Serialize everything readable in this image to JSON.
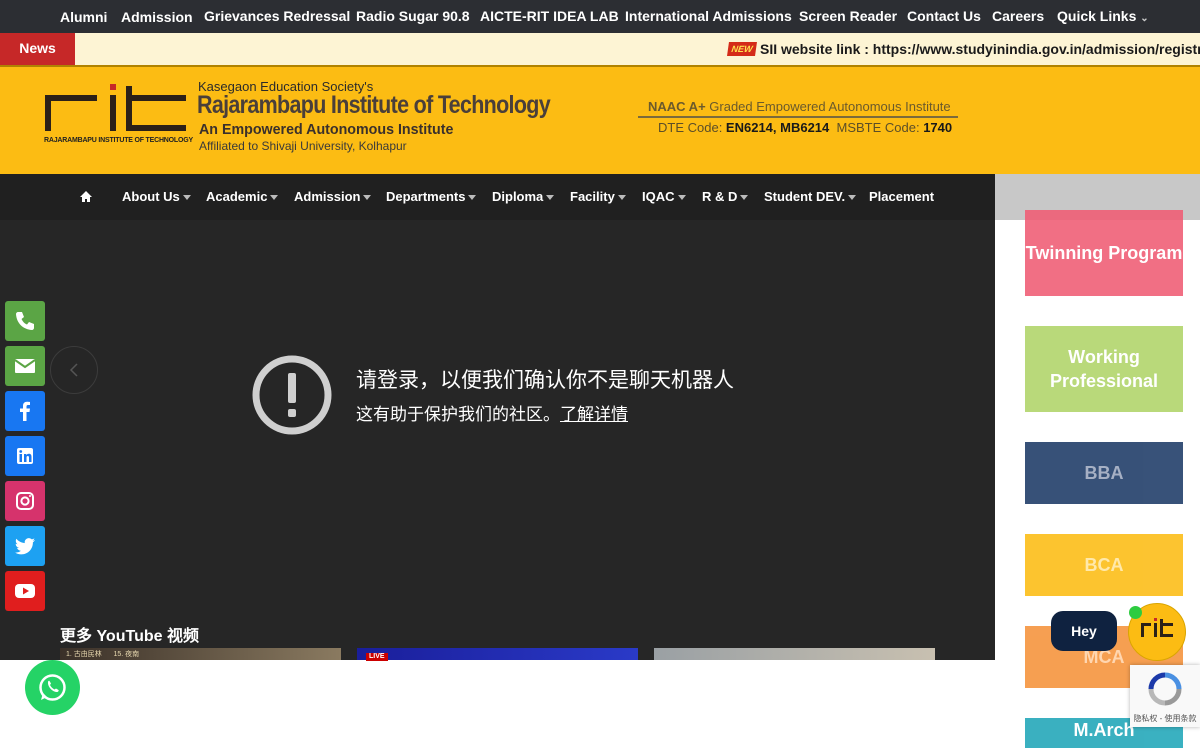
{
  "topbar": {
    "items": [
      "Alumni",
      "Admission",
      "Grievances Redressal",
      "Radio Sugar 90.8",
      "AICTE-RIT IDEA LAB",
      "International Admissions",
      "Screen Reader",
      "Contact Us",
      "Careers",
      "Quick Links"
    ]
  },
  "news": {
    "label": "News",
    "badge": "NEW",
    "text": "SII website link : https://www.studyinindia.gov.in/admission/registration"
  },
  "header": {
    "logo_caption": "RAJARAMBAPU INSTITUTE OF TECHNOLOGY",
    "society": "Kasegaon Education Society's",
    "name": "Rajarambapu Institute of Technology",
    "tagline": "An Empowered Autonomous Institute",
    "affiliation": "Affiliated to Shivaji University, Kolhapur",
    "naac_strong": "NAAC A+",
    "naac_rest": " Graded Empowered Autonomous Institute",
    "dte_label": "DTE Code: ",
    "dte_value": "EN6214, MB6214",
    "msbte_label": "  MSBTE Code: ",
    "msbte_value": "1740"
  },
  "nav": {
    "items": [
      "About Us",
      "Academic",
      "Admission",
      "Departments",
      "Diploma",
      "Facility",
      "IQAC",
      "R & D",
      "Student DEV.",
      "Placement"
    ]
  },
  "video": {
    "message": "请登录，以便我们确认你不是聊天机器人",
    "sub_text": "这有助于保护我们的社区。",
    "sub_link": "了解详情",
    "more": "更多 YouTube 视频",
    "live_badge": "LIVE",
    "thumb1_text": "1. 古由民林      15. 夜南"
  },
  "programs": {
    "cards": [
      "Twinning Program",
      "Working Professional",
      "BBA",
      "BCA",
      "MCA",
      "M.Arch"
    ]
  },
  "chat": {
    "greeting": "Hey",
    "bot_logo": "rit"
  },
  "recaptcha": {
    "text": "隐私权 - 使用条款"
  },
  "colors": {
    "header": "#fcbc13",
    "topbar": "#2c2e33",
    "navbar": "#202020",
    "news_label": "#c62828"
  }
}
